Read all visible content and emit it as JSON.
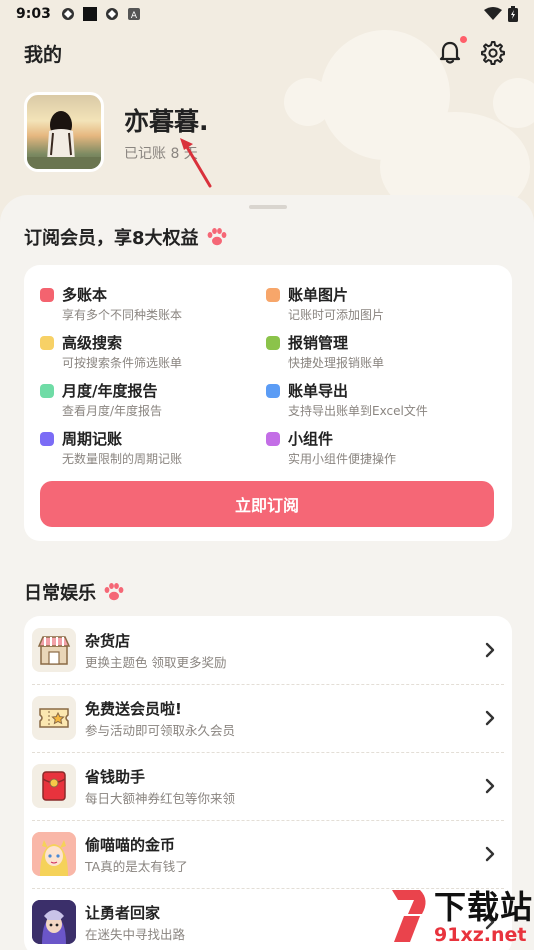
{
  "status_bar": {
    "time": "9:03"
  },
  "header": {
    "title": "我的"
  },
  "profile": {
    "name": "亦暮暮.",
    "records": "已记账 8 天"
  },
  "membership": {
    "title": "订阅会员，享8大权益",
    "benefits": [
      {
        "title": "多账本",
        "desc": "享有多个不同种类账本",
        "color": "#f4636f"
      },
      {
        "title": "账单图片",
        "desc": "记账时可添加图片",
        "color": "#f7a66a"
      },
      {
        "title": "高级搜索",
        "desc": "可按搜索条件筛选账单",
        "color": "#f7d166"
      },
      {
        "title": "报销管理",
        "desc": "快捷处理报销账单",
        "color": "#8bc34a"
      },
      {
        "title": "月度/年度报告",
        "desc": "查看月度/年度报告",
        "color": "#6fdca6"
      },
      {
        "title": "账单导出",
        "desc": "支持导出账单到Excel文件",
        "color": "#5b9cf5"
      },
      {
        "title": "周期记账",
        "desc": "无数量限制的周期记账",
        "color": "#7b6cf6"
      },
      {
        "title": "小组件",
        "desc": "实用小组件便捷操作",
        "color": "#c36ee6"
      }
    ],
    "button": "立即订阅"
  },
  "entertainment": {
    "title": "日常娱乐",
    "items": [
      {
        "title": "杂货店",
        "desc": "更换主题色 领取更多奖励",
        "icon": "shop-icon"
      },
      {
        "title": "免费送会员啦!",
        "desc": "参与活动即可领取永久会员",
        "icon": "ticket-icon"
      },
      {
        "title": "省钱助手",
        "desc": "每日大额神券红包等你来领",
        "icon": "red-envelope-icon"
      },
      {
        "title": "偷喵喵的金币",
        "desc": "TA真的是太有钱了",
        "icon": "cat-girl-icon"
      },
      {
        "title": "让勇者回家",
        "desc": "在迷失中寻找出路",
        "icon": "hero-icon"
      }
    ]
  },
  "watermark": {
    "text": "下载站",
    "url": "91xz.net"
  },
  "colors": {
    "accent": "#f56776",
    "background": "#f2ece1"
  }
}
